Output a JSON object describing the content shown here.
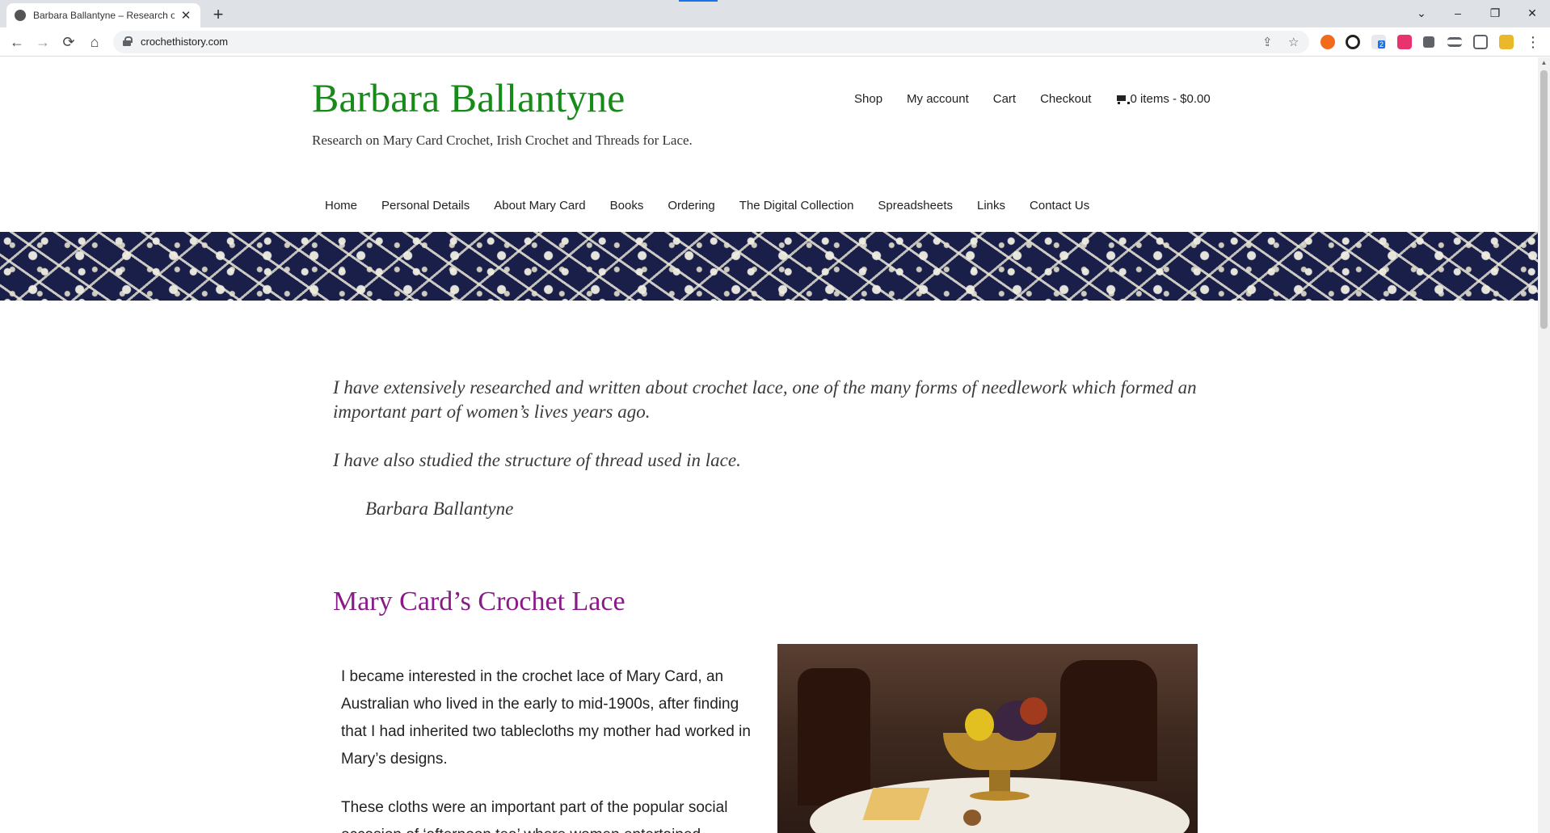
{
  "browser": {
    "tab_title": "Barbara Ballantyne – Research on Mary Card Crochet",
    "url": "crochethistory.com",
    "new_tab": "+",
    "tab_close": "✕",
    "back": "←",
    "forward": "→",
    "reload": "⟳",
    "home": "⌂",
    "share": "⇪",
    "star": "☆",
    "tab_search": "⌄",
    "minimize": "–",
    "restore": "❐",
    "close": "✕",
    "menu": "⋮",
    "extension_badge": "2",
    "scroll_up": "▲"
  },
  "site": {
    "title": "Barbara Ballantyne",
    "description": "Research on Mary Card Crochet, Irish Crochet and Threads for Lace."
  },
  "top_nav": {
    "shop": "Shop",
    "account": "My account",
    "cart": "Cart",
    "checkout": "Checkout",
    "cart_summary": "0 items - $0.00"
  },
  "main_nav": {
    "home": "Home",
    "personal": "Personal Details",
    "about": "About Mary Card",
    "books": "Books",
    "ordering": "Ordering",
    "digital": "The Digital Collection",
    "spreadsheets": "Spreadsheets",
    "links": "Links",
    "contact": "Contact Us"
  },
  "content": {
    "quote_1": "I have extensively researched and written about crochet lace, one of the many forms of needlework which formed an important part of women’s lives years ago.",
    "quote_2": "I have also studied the structure of thread used in lace.",
    "signature": "Barbara Ballantyne",
    "section_heading": "Mary Card’s Crochet Lace",
    "paragraph_1": "I became interested in the crochet lace of Mary Card, an Australian who lived in the early to mid-1900s, after finding that I had inherited two tablecloths my mother had worked in Mary’s designs.",
    "paragraph_2": "These cloths were an important part of the popular social occasion of ‘afternoon tea’ where women entertained"
  },
  "colors": {
    "site_title": "#188a1a",
    "section_heading": "#8a1a8a",
    "banner_base": "#1a1f4a"
  }
}
